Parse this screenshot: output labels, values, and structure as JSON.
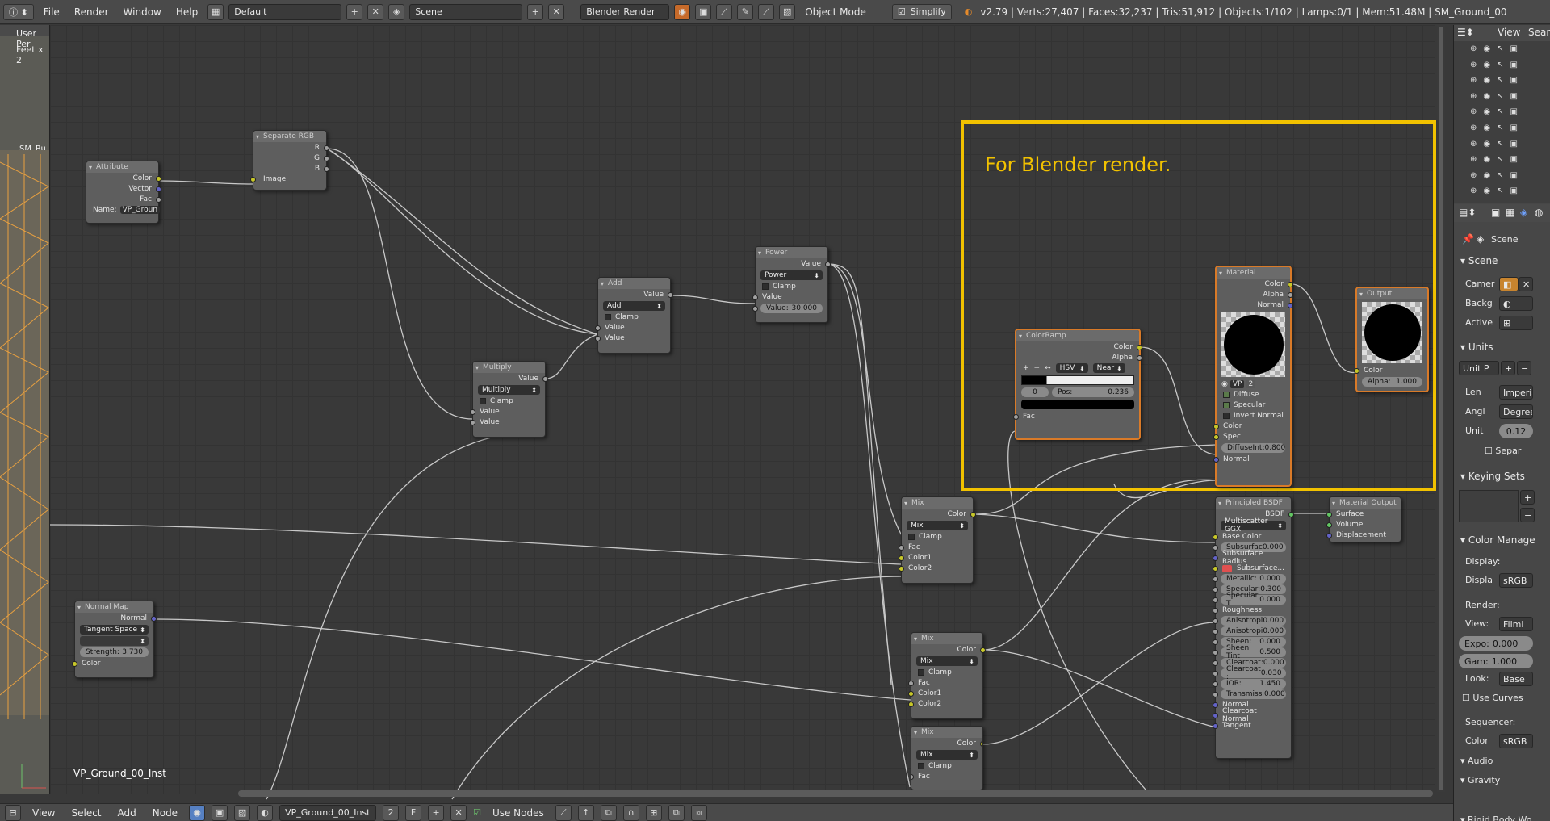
{
  "topbar": {
    "menus": [
      "File",
      "Render",
      "Window",
      "Help"
    ],
    "layout": "Default",
    "scene": "Scene",
    "engine": "Blender Render",
    "mode": "Object Mode",
    "simplify": "Simplify",
    "stats": "v2.79 | Verts:27,407 | Faces:32,237 | Tris:51,912 | Objects:1/102 | Lamps:0/1 | Mem:51.48M | SM_Ground_00"
  },
  "viewport_left": {
    "line1": "User Per",
    "line2": "Feet x 2",
    "object": "SM_Ru"
  },
  "annotation": "For Blender render.",
  "editor_label": "VP_Ground_00_Inst",
  "nodes": {
    "attribute": {
      "title": "Attribute",
      "out": [
        "Color",
        "Vector",
        "Fac"
      ],
      "name_label": "Name:",
      "name_value": "VP_Groun"
    },
    "separate_rgb": {
      "title": "Separate RGB",
      "out": [
        "R",
        "G",
        "B"
      ],
      "in": "Image"
    },
    "multiply": {
      "title": "Multiply",
      "out": "Value",
      "op": "Multiply",
      "clamp": "Clamp",
      "in": [
        "Value",
        "Value"
      ]
    },
    "add": {
      "title": "Add",
      "out": "Value",
      "op": "Add",
      "clamp": "Clamp",
      "in": [
        "Value",
        "Value"
      ]
    },
    "power": {
      "title": "Power",
      "out": "Value",
      "op": "Power",
      "clamp": "Clamp",
      "in": "Value",
      "value_label": "Value:",
      "value": "30.000"
    },
    "normal_map": {
      "title": "Normal Map",
      "out": "Normal",
      "space": "Tangent Space",
      "strength_label": "Strength:",
      "strength": "3.730",
      "in": "Color"
    },
    "mix1": {
      "title": "Mix",
      "out": "Color",
      "op": "Mix",
      "clamp": "Clamp",
      "in": [
        "Fac",
        "Color1",
        "Color2"
      ]
    },
    "mix2": {
      "title": "Mix",
      "out": "Color",
      "op": "Mix",
      "clamp": "Clamp",
      "in": [
        "Fac",
        "Color1",
        "Color2"
      ]
    },
    "mix3": {
      "title": "Mix",
      "out": "Color",
      "op": "Mix",
      "clamp": "Clamp",
      "in": [
        "Fac"
      ]
    },
    "colorramp": {
      "title": "ColorRamp",
      "out": [
        "Color",
        "Alpha"
      ],
      "mode": "HSV",
      "interp": "Near",
      "index": "0",
      "pos_label": "Pos:",
      "pos": "0.236",
      "in": "Fac"
    },
    "material": {
      "title": "Material",
      "out": [
        "Color",
        "Alpha",
        "Normal"
      ],
      "mat": "VP",
      "users": "2",
      "diffuse": "Diffuse",
      "specular": "Specular",
      "invert": "Invert Normal",
      "in": [
        "Color",
        "Spec"
      ],
      "diffint_label": "DiffuseInt:",
      "diffint": "0.800",
      "normal_in": "Normal"
    },
    "output": {
      "title": "Output",
      "in": "Color",
      "alpha_label": "Alpha:",
      "alpha": "1.000"
    },
    "principled": {
      "title": "Principled BSDF",
      "out": "BSDF",
      "dist": "Multiscatter GGX",
      "fields": [
        {
          "label": "Base Color",
          "value": ""
        },
        {
          "label": "Subsurfac",
          "value": "0.000"
        },
        {
          "label": "Subsurface Radius",
          "value": ""
        },
        {
          "label": "Subsurface...",
          "value": ""
        },
        {
          "label": "Metallic:",
          "value": "0.000"
        },
        {
          "label": "Specular:",
          "value": "0.300"
        },
        {
          "label": "Specular T",
          "value": "0.000"
        },
        {
          "label": "Roughness",
          "value": ""
        },
        {
          "label": "Anisotropi",
          "value": "0.000"
        },
        {
          "label": "Anisotropi",
          "value": "0.000"
        },
        {
          "label": "Sheen:",
          "value": "0.000"
        },
        {
          "label": "Sheen Tint",
          "value": "0.500"
        },
        {
          "label": "Clearcoat:",
          "value": "0.000"
        },
        {
          "label": "Clearcoat :",
          "value": "0.030"
        },
        {
          "label": "IOR:",
          "value": "1.450"
        },
        {
          "label": "Transmissi",
          "value": "0.000"
        },
        {
          "label": "Normal",
          "value": ""
        },
        {
          "label": "Clearcoat Normal",
          "value": ""
        },
        {
          "label": "Tangent",
          "value": ""
        }
      ]
    },
    "material_output": {
      "title": "Material Output",
      "in": [
        "Surface",
        "Volume",
        "Displacement"
      ]
    }
  },
  "rightpanel": {
    "outliner_view": "View",
    "outliner_search": "Searc",
    "breadcrumb": "Scene",
    "scene_section": "Scene",
    "camera_label": "Camer",
    "background_label": "Backg",
    "active_label": "Active",
    "units_section": "Units",
    "unit_preset": "Unit P",
    "length_label": "Len",
    "length_value": "Imperia",
    "angle_label": "Angl",
    "angle_value": "Degree",
    "unit_scale_label": "Unit",
    "unit_scale": "0.12",
    "separate": "Separ",
    "keying_section": "Keying Sets",
    "color_section": "Color Manage",
    "display_label": "Display:",
    "display_device_label": "Displa",
    "display_device": "sRGB",
    "render_label": "Render:",
    "view_label": "View:",
    "view_value": "Filmi",
    "exposure_label": "Expo:",
    "exposure": "0.000",
    "gamma_label": "Gam:",
    "gamma": "1.000",
    "look_label": "Look:",
    "look_value": "Base",
    "use_curves": "Use Curves",
    "sequencer_label": "Sequencer:",
    "seq_color_label": "Color",
    "seq_color": "sRGB",
    "audio_section": "Audio",
    "gravity_section": "Gravity",
    "rigid_section": "Rigid Body Wo"
  },
  "bottombar": {
    "menus": [
      "View",
      "Select",
      "Add",
      "Node"
    ],
    "material": "VP_Ground_00_Inst",
    "users": "2",
    "fake": "F",
    "use_nodes": "Use Nodes"
  },
  "colors": {
    "accent": "#f2c200",
    "selected": "#d97a28",
    "socket_color": "#c7c729",
    "socket_value": "#a1a1a1",
    "socket_vector": "#6363c7",
    "socket_shader": "#63c763"
  }
}
